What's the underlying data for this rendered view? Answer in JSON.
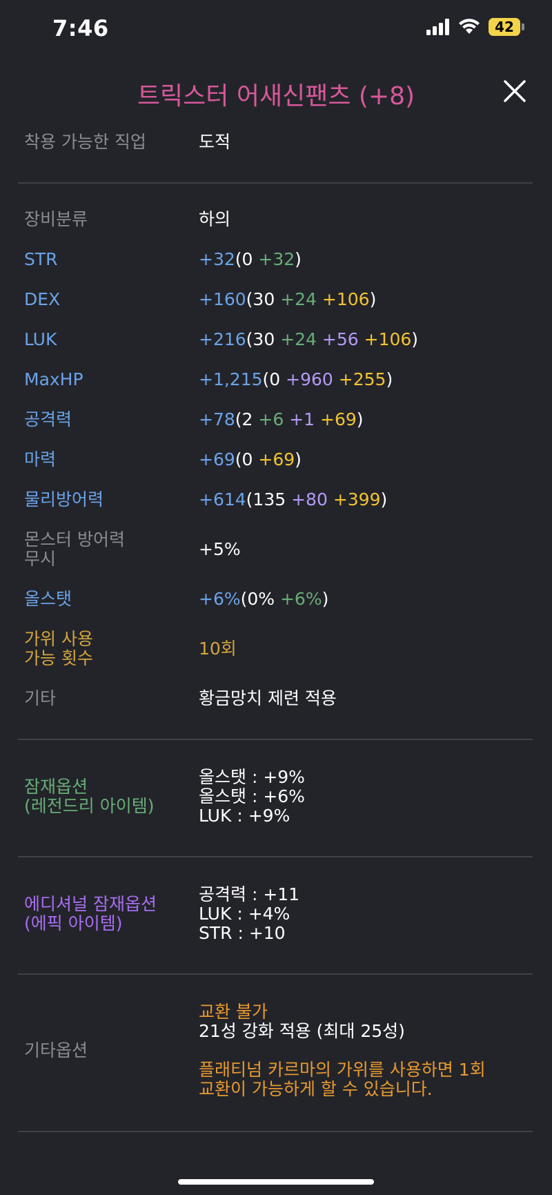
{
  "status": {
    "time": "7:46",
    "battery": "42"
  },
  "header": {
    "title": "트릭스터 어새신팬츠 (+8)"
  },
  "job": {
    "label": "착용 가능한 직업",
    "value": "도적"
  },
  "stats": {
    "category": {
      "label": "장비분류",
      "value": "하의"
    },
    "str": {
      "label": "STR",
      "total": "+32",
      "open": "(0 ",
      "add": "+32",
      "close": ")"
    },
    "dex": {
      "label": "DEX",
      "total": "+160",
      "open": "(30 ",
      "add": "+24",
      "star": "+106",
      "close": ")"
    },
    "luk": {
      "label": "LUK",
      "total": "+216",
      "open": "(30 ",
      "add": "+24",
      "scroll": "+56",
      "star": "+106",
      "close": ")"
    },
    "maxhp": {
      "label": "MaxHP",
      "total": "+1,215",
      "open": "(0 ",
      "scroll": "+960",
      "star": "+255",
      "close": ")"
    },
    "attack": {
      "label": "공격력",
      "total": "+78",
      "open": "(2 ",
      "add": "+6",
      "scroll": "+1",
      "star": "+69",
      "close": ")"
    },
    "magic": {
      "label": "마력",
      "total": "+69",
      "open": "(0 ",
      "star": "+69",
      "close": ")"
    },
    "defense": {
      "label": "물리방어력",
      "total": "+614",
      "open": "(135 ",
      "scroll": "+80",
      "star": "+399",
      "close": ")"
    },
    "ignore": {
      "label_line1": "몬스터 방어력",
      "label_line2": "무시",
      "value": "+5%"
    },
    "allstat": {
      "label": "올스탯",
      "total": "+6%",
      "open": "(0% ",
      "add": "+6%",
      "close": ")"
    },
    "scissors": {
      "label_line1": "가위 사용",
      "label_line2": "가능 횟수",
      "value": "10회"
    },
    "etc": {
      "label": "기타",
      "value": "황금망치 제련 적용"
    }
  },
  "potential": {
    "label_line1": "잠재옵션",
    "label_line2": "(레전드리 아이템)",
    "lines": [
      "올스탯 : +9%",
      "올스탯 : +6%",
      "LUK : +9%"
    ]
  },
  "additional": {
    "label_line1": "에디셔널 잠재옵션",
    "label_line2": "(에픽 아이템)",
    "lines": [
      "공격력 : +11",
      "LUK : +4%",
      "STR : +10"
    ]
  },
  "other": {
    "label": "기타옵션",
    "trade": "교환 불가",
    "star": "21성 강화 적용 (최대 25성)",
    "karma_line1": "플래티넘 카르마의 가위를 사용하면 1회",
    "karma_line2": "교환이 가능하게 할 수 있습니다."
  },
  "colors": {
    "background": "#23242a",
    "title": "#d8589a",
    "stat_blue": "#6aa3e8",
    "bonus_green": "#68ad76",
    "star_yellow": "#f2c330",
    "scroll_purple": "#b49af5",
    "legendary_green": "#68ad76",
    "epic_purple": "#a86ef2",
    "notice_orange": "#e89a2e"
  },
  "icons": [
    "signal-icon",
    "wifi-icon",
    "battery-icon",
    "close-icon"
  ]
}
